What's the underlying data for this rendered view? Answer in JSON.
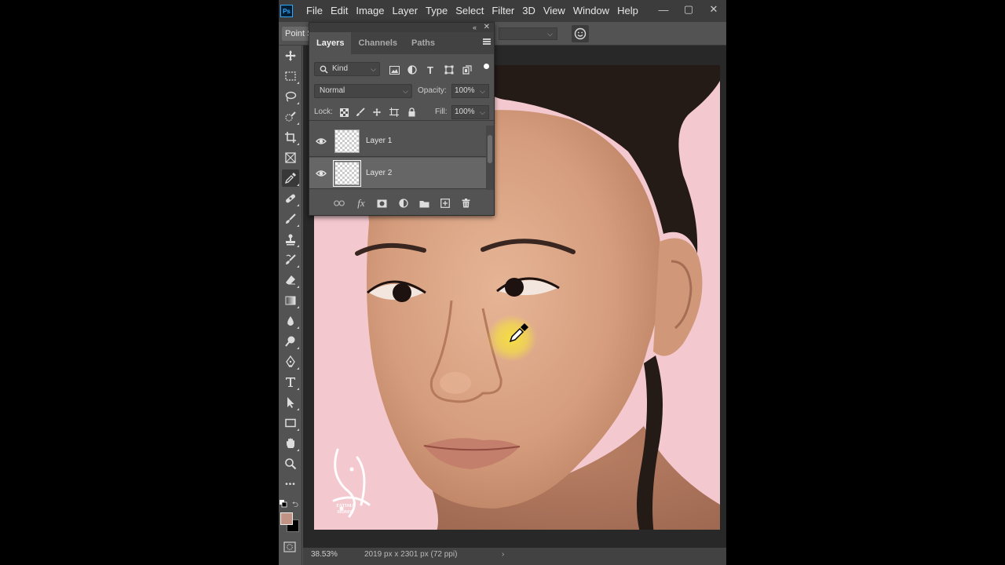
{
  "app": {
    "logo_text": "Ps",
    "menu": [
      "File",
      "Edit",
      "Image",
      "Layer",
      "Type",
      "Select",
      "Filter",
      "3D",
      "View",
      "Window",
      "Help"
    ],
    "window_controls": {
      "minimize": "—",
      "restore": "▢",
      "close": "✕"
    }
  },
  "options_bar": {
    "tool_option_label": "Point S",
    "dropdown_chevron": "⌵"
  },
  "layers_panel": {
    "tabs": [
      "Layers",
      "Channels",
      "Paths"
    ],
    "collapse_glyph": "«",
    "close_glyph": "✕",
    "filter_kind": "Kind",
    "blend_mode": "Normal",
    "opacity_label": "Opacity:",
    "opacity_value": "100%",
    "lock_label": "Lock:",
    "fill_label": "Fill:",
    "fill_value": "100%",
    "layers": [
      {
        "name": "Layer 1",
        "selected": false
      },
      {
        "name": "Layer 2",
        "selected": true
      }
    ],
    "footer_fx": "fx"
  },
  "toolbar": {
    "foreground_color": "#c09384",
    "background_color": "#000000",
    "more_tools": "•••"
  },
  "status_bar": {
    "zoom": "38.53%",
    "doc_size": "2019 px x 2301 px (72 ppi)",
    "arrow": "›"
  },
  "watermark": {
    "text_line1": "FATIMA",
    "text_line2": "HOMSI"
  },
  "colors": {
    "canvas_background": "#f3c8cf",
    "brush_highlight": "#f5e040"
  }
}
